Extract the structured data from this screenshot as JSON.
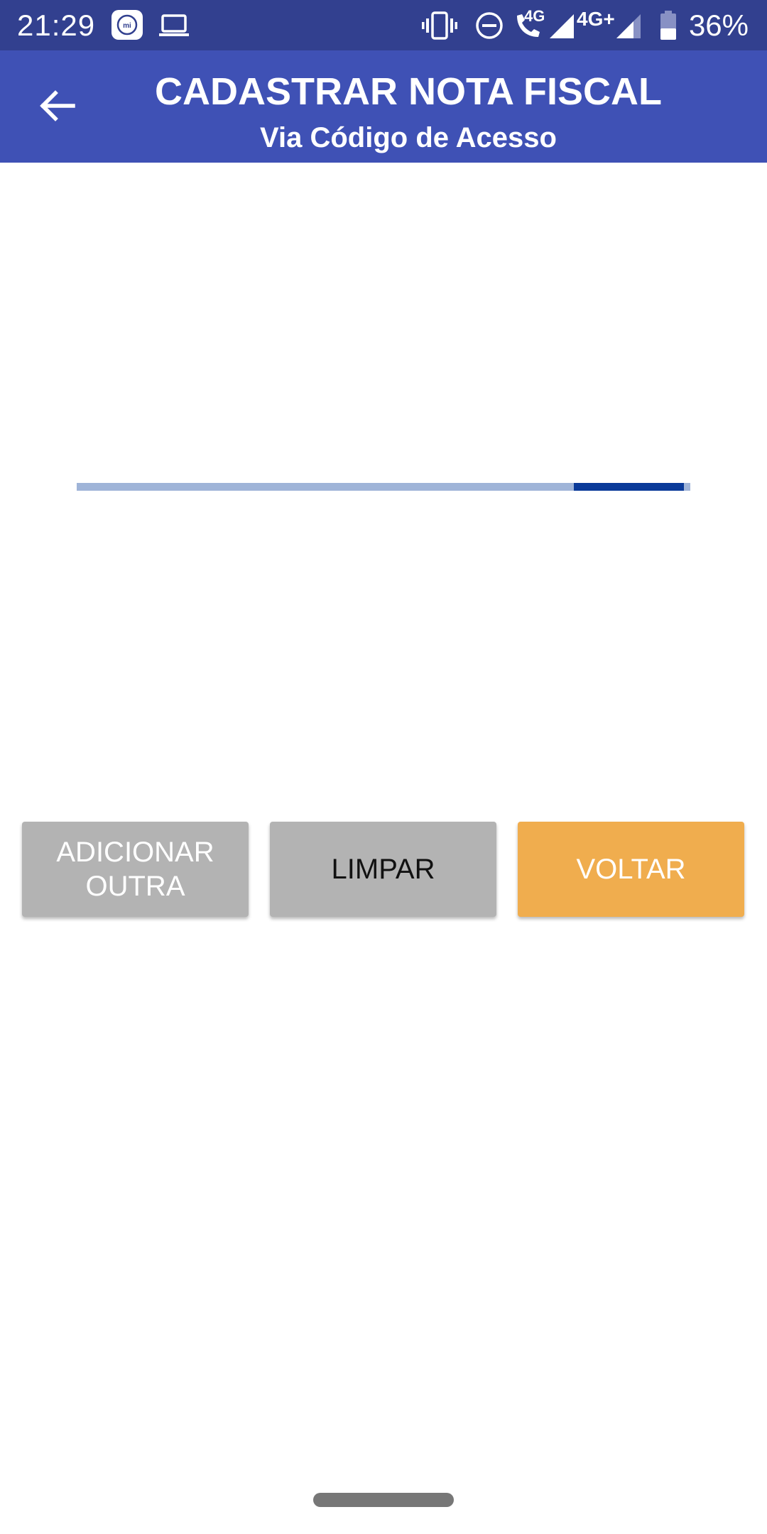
{
  "status_bar": {
    "time": "21:29",
    "lte_label": "4G",
    "network_label": "4G+",
    "battery_percent": "36%",
    "icons": [
      "mi-icon",
      "laptop-icon",
      "vibrate-icon",
      "do-not-disturb-icon",
      "wifi-call-icon",
      "signal-icon",
      "signal-icon",
      "battery-icon"
    ]
  },
  "app_bar": {
    "title": "CADASTRAR NOTA FISCAL",
    "subtitle": "Via Código de Acesso",
    "back_icon": "arrow-back-icon",
    "background_color": "#3f51b5",
    "status_bar_color": "#32408f"
  },
  "progress": {
    "type": "indeterminate",
    "indicator_start": 0.81,
    "indicator_end": 0.99,
    "track_color": "#9fb4d8",
    "indicator_color": "#0a3a99"
  },
  "buttons": {
    "add_other": "ADICIONAR OUTRA",
    "clear": "LIMPAR",
    "back": "VOLTAR",
    "gray_color": "#b3b3b3",
    "accent_color": "#f0ad4e"
  }
}
